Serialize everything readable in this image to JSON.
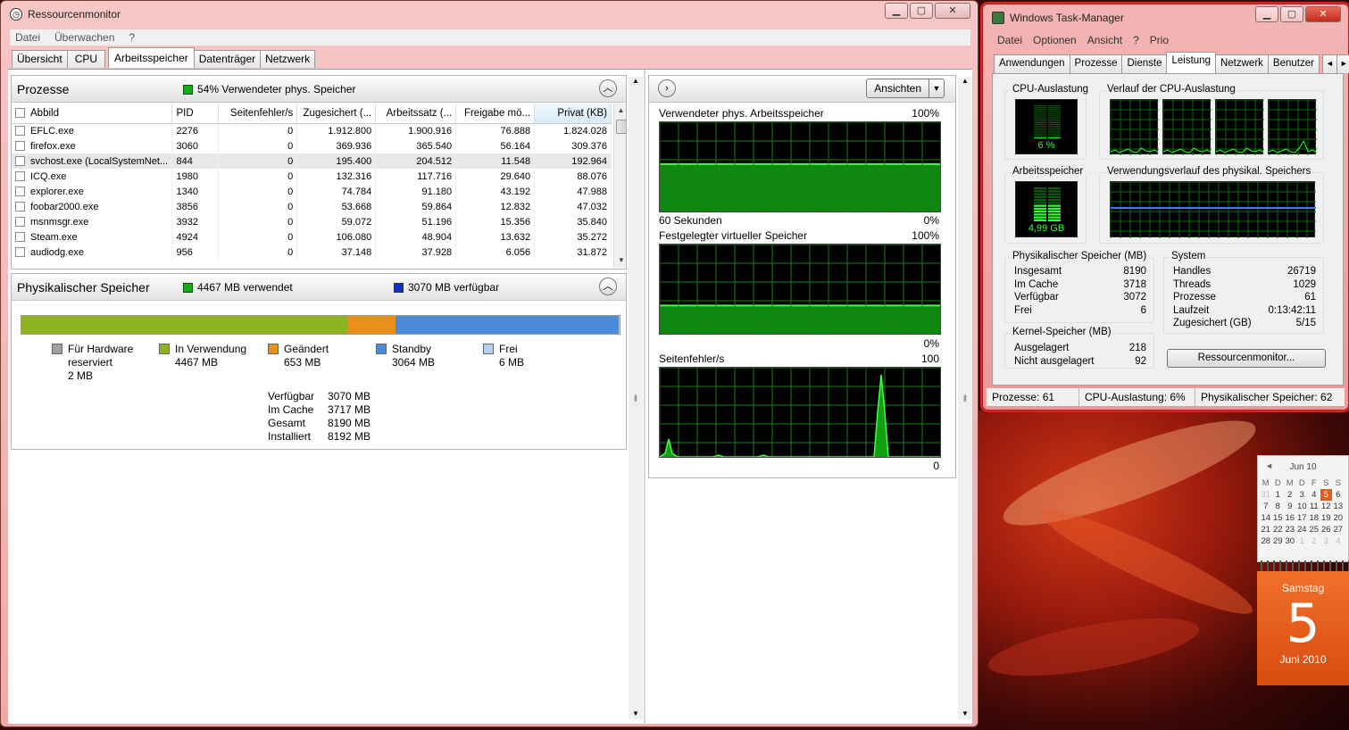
{
  "resmon": {
    "title": "Ressourcenmonitor",
    "menu": [
      "Datei",
      "Überwachen",
      "?"
    ],
    "tabs": [
      "Übersicht",
      "CPU",
      "Arbeitsspeicher",
      "Datenträger",
      "Netzwerk"
    ],
    "active_tab": "Arbeitsspeicher",
    "processes": {
      "title": "Prozesse",
      "info": "54% Verwendeter phys. Speicher",
      "info_color": "#10b010",
      "columns": [
        "Abbild",
        "PID",
        "Seitenfehler/s",
        "Zugesichert (...",
        "Arbeitssatz (...",
        "Freigabe mö...",
        "Privat (KB)"
      ],
      "rows": [
        [
          "EFLC.exe",
          "2276",
          "0",
          "1.912.800",
          "1.900.916",
          "76.888",
          "1.824.028"
        ],
        [
          "firefox.exe",
          "3060",
          "0",
          "369.936",
          "365.540",
          "56.164",
          "309.376"
        ],
        [
          "svchost.exe (LocalSystemNet...",
          "844",
          "0",
          "195.400",
          "204.512",
          "11.548",
          "192.964"
        ],
        [
          "ICQ.exe",
          "1980",
          "0",
          "132.316",
          "117.716",
          "29.640",
          "88.076"
        ],
        [
          "explorer.exe",
          "1340",
          "0",
          "74.784",
          "91.180",
          "43.192",
          "47.988"
        ],
        [
          "foobar2000.exe",
          "3856",
          "0",
          "53.668",
          "59.864",
          "12.832",
          "47.032"
        ],
        [
          "msnmsgr.exe",
          "3932",
          "0",
          "59.072",
          "51.196",
          "15.356",
          "35.840"
        ],
        [
          "Steam.exe",
          "4924",
          "0",
          "106.080",
          "48.904",
          "13.632",
          "35.272"
        ],
        [
          "audiodg.exe",
          "956",
          "0",
          "37.148",
          "37.928",
          "6.056",
          "31.872"
        ]
      ]
    },
    "physical": {
      "title": "Physikalischer Speicher",
      "used_info": "4467 MB verwendet",
      "free_info": "3070 MB verfügbar",
      "used_color": "#10b010",
      "free_color": "#1030c0",
      "bar": [
        {
          "name": "In Verwendung",
          "mb": 4467,
          "color": "#8db320"
        },
        {
          "name": "Geändert",
          "mb": 653,
          "color": "#e8901a"
        },
        {
          "name": "Standby",
          "mb": 3064,
          "color": "#4a8ad8"
        },
        {
          "name": "Frei",
          "mb": 6,
          "color": "#b4d0f0"
        }
      ],
      "legend": [
        {
          "label": "Für Hardware reserviert",
          "line1": "Für Hardware",
          "line2": "reserviert",
          "value": "2 MB",
          "color": "#a0a0a0"
        },
        {
          "label": "In Verwendung",
          "value": "4467 MB",
          "color": "#8db320"
        },
        {
          "label": "Geändert",
          "value": "653 MB",
          "color": "#e8901a"
        },
        {
          "label": "Standby",
          "value": "3064 MB",
          "color": "#4a8ad8"
        },
        {
          "label": "Frei",
          "value": "6 MB",
          "color": "#b4d0f0"
        }
      ],
      "stats": [
        {
          "k": "Verfügbar",
          "v": "3070 MB"
        },
        {
          "k": "Im Cache",
          "v": "3717 MB"
        },
        {
          "k": "Gesamt",
          "v": "8190 MB"
        },
        {
          "k": "Installiert",
          "v": "8192 MB"
        }
      ]
    },
    "graphs": {
      "views_button": "Ansichten",
      "g1_title": "Verwendeter phys. Arbeitsspeicher",
      "g1_max": "100%",
      "g1_min": "0%",
      "g1_time": "60 Sekunden",
      "g1_level_pct": 54,
      "g2_title": "Festgelegter virtueller Speicher",
      "g2_max": "100%",
      "g2_min": "0%",
      "g2_level_pct": 33,
      "g3_title": "Seitenfehler/s",
      "g3_max": "100",
      "g3_min": "0"
    }
  },
  "taskmgr": {
    "title": "Windows Task-Manager",
    "menu": [
      "Datei",
      "Optionen",
      "Ansicht",
      "?",
      "Prio"
    ],
    "tabs": [
      "Anwendungen",
      "Prozesse",
      "Dienste",
      "Leistung",
      "Netzwerk",
      "Benutzer"
    ],
    "active_tab": "Leistung",
    "cpu_label": "CPU-Auslastung",
    "cpu_value": "6 %",
    "cpu_fraction": 0.06,
    "cpu_history_label": "Verlauf der CPU-Auslastung",
    "mem_label": "Arbeitsspeicher",
    "mem_value": "4,99 GB",
    "mem_fraction": 0.54,
    "mem_history_label": "Verwendungsverlauf des physikal. Speichers",
    "phys": {
      "title": "Physikalischer Speicher (MB)",
      "rows": [
        [
          "Insgesamt",
          "8190"
        ],
        [
          "Im Cache",
          "3718"
        ],
        [
          "Verfügbar",
          "3072"
        ],
        [
          "Frei",
          "6"
        ]
      ]
    },
    "system": {
      "title": "System",
      "rows": [
        [
          "Handles",
          "26719"
        ],
        [
          "Threads",
          "1029"
        ],
        [
          "Prozesse",
          "61"
        ],
        [
          "Laufzeit",
          "0:13:42:11"
        ],
        [
          "Zugesichert (GB)",
          "5/15"
        ]
      ]
    },
    "kernel": {
      "title": "Kernel-Speicher (MB)",
      "rows": [
        [
          "Ausgelagert",
          "218"
        ],
        [
          "Nicht ausgelagert",
          "92"
        ]
      ]
    },
    "resmon_button": "Ressourcenmonitor...",
    "status": [
      "Prozesse: 61",
      "CPU-Auslastung: 6%",
      "Physikalischer Speicher: 62"
    ]
  },
  "calendar": {
    "month_label": "Jun 10",
    "weekdays": [
      "M",
      "D",
      "M",
      "D",
      "F",
      "S",
      "S"
    ],
    "days": [
      [
        "31",
        "1",
        "2",
        "3",
        "4",
        "5",
        "6"
      ],
      [
        "7",
        "8",
        "9",
        "10",
        "11",
        "12",
        "13"
      ],
      [
        "14",
        "15",
        "16",
        "17",
        "18",
        "19",
        "20"
      ],
      [
        "21",
        "22",
        "23",
        "24",
        "25",
        "26",
        "27"
      ],
      [
        "28",
        "29",
        "30",
        "1",
        "2",
        "3",
        "4"
      ]
    ],
    "weekday_name": "Samstag",
    "day_number": "5",
    "month_year": "Juni 2010",
    "accent_color": "#e35d1f"
  }
}
